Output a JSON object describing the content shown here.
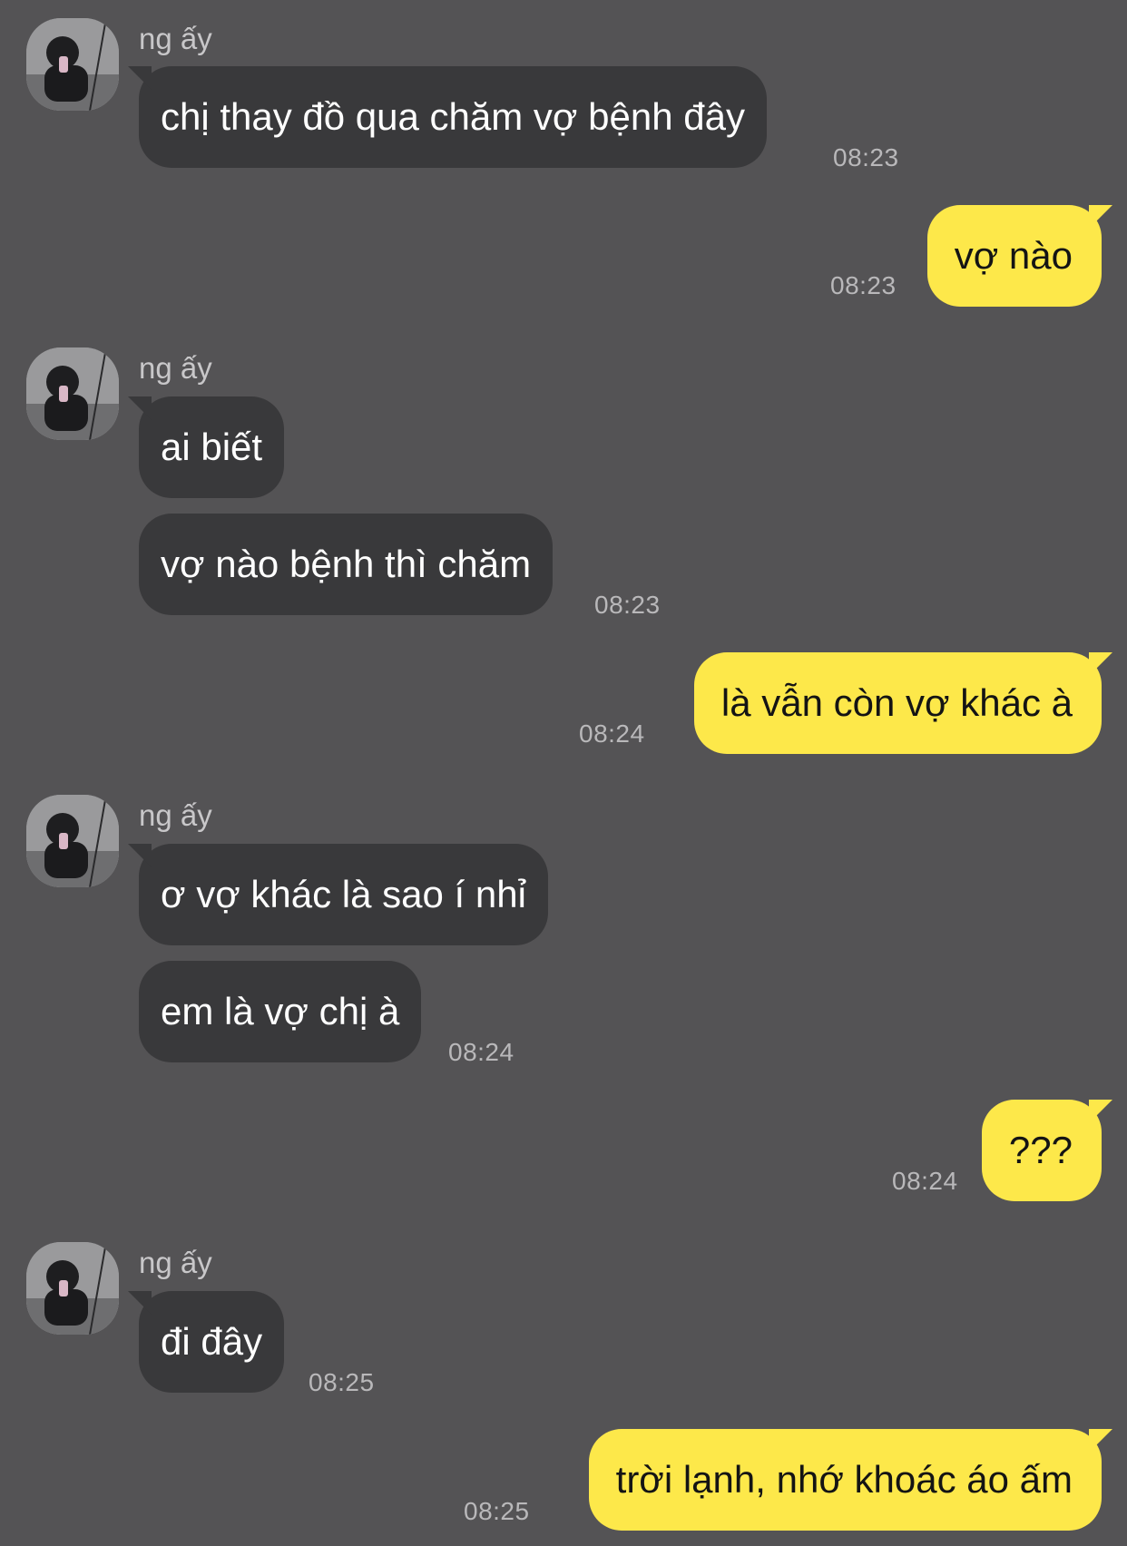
{
  "contact": {
    "name": "ng ấy"
  },
  "messages": [
    {
      "from": "them",
      "text": "chị thay đồ qua chăm vợ bệnh đây",
      "time": "08:23"
    },
    {
      "from": "me",
      "text": "vợ nào",
      "time": "08:23"
    },
    {
      "from": "them",
      "text": "ai biết",
      "time": ""
    },
    {
      "from": "them",
      "text": "vợ nào bệnh thì chăm",
      "time": "08:23"
    },
    {
      "from": "me",
      "text": "là vẫn còn vợ khác à",
      "time": "08:24"
    },
    {
      "from": "them",
      "text": "ơ vợ khác là sao í nhỉ",
      "time": ""
    },
    {
      "from": "them",
      "text": "em là vợ chị à",
      "time": "08:24"
    },
    {
      "from": "me",
      "text": "???",
      "time": "08:24"
    },
    {
      "from": "them",
      "text": "đi đây",
      "time": "08:25"
    },
    {
      "from": "me",
      "text": "trời lạnh, nhớ khoác áo ấm",
      "time": "08:25"
    }
  ],
  "colors": {
    "background": "#545355",
    "incoming_bubble": "#39393b",
    "outgoing_bubble": "#fde84a",
    "incoming_text": "#ffffff",
    "outgoing_text": "#141414",
    "timestamp": "#b9b8ba"
  },
  "icons": {
    "avatar": "contact-avatar-photo"
  }
}
